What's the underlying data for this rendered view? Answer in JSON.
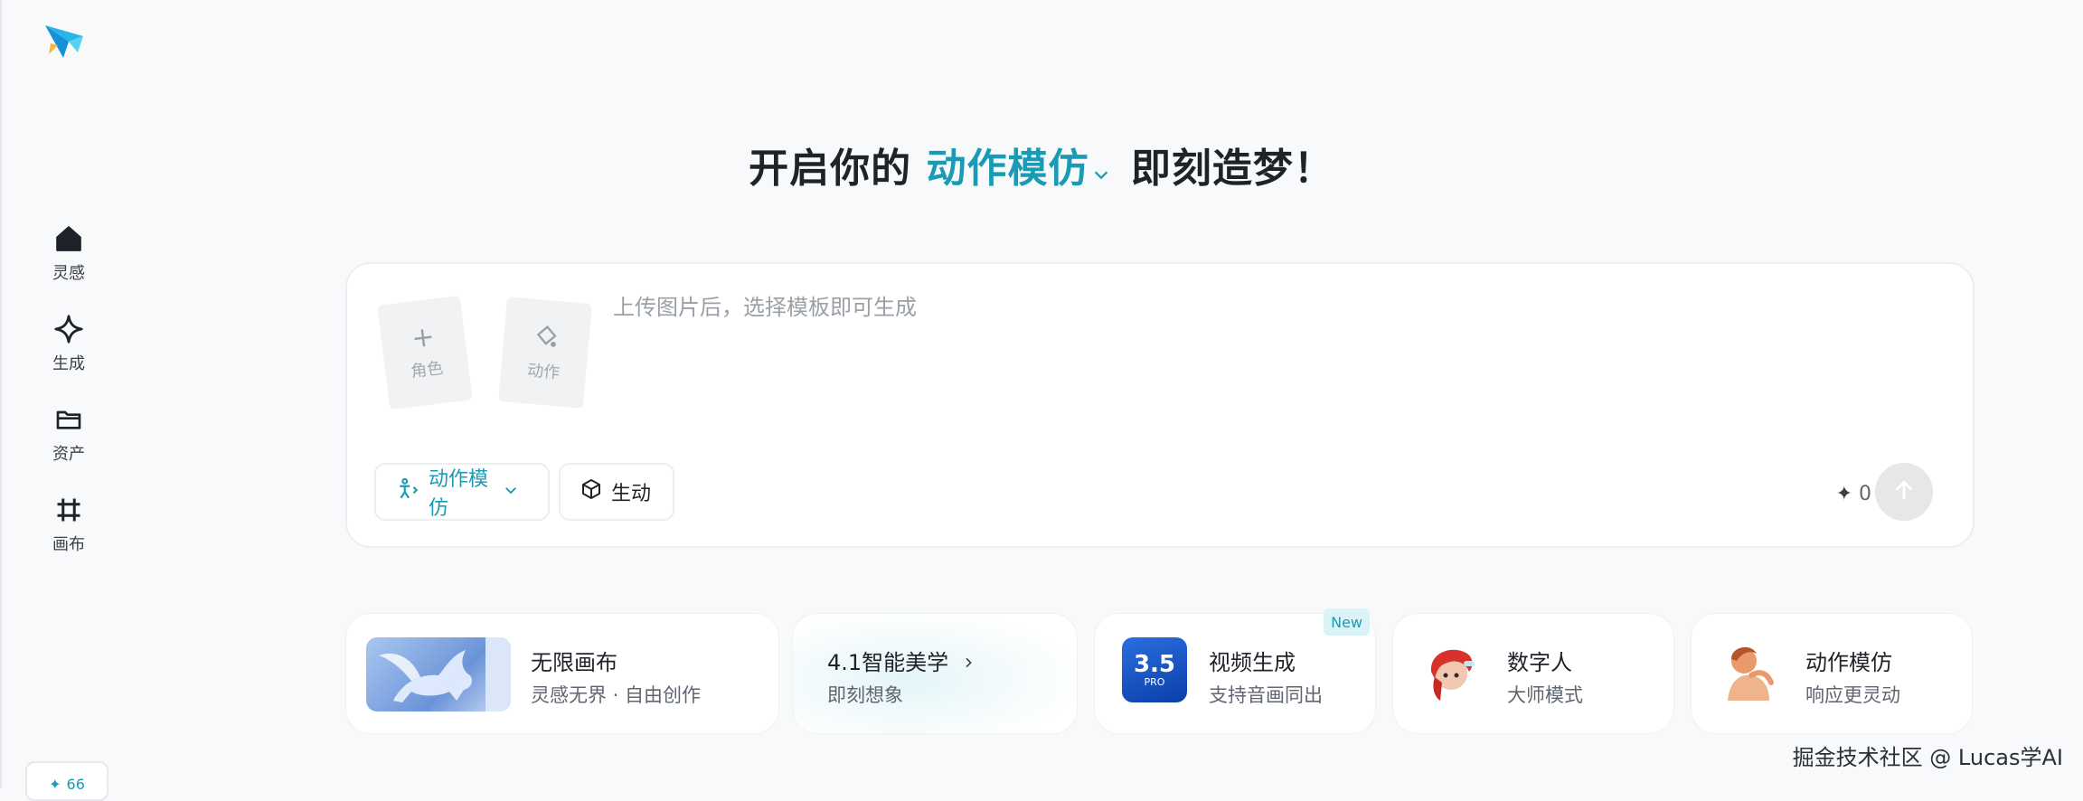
{
  "sidebar": {
    "items": [
      {
        "label": "灵感",
        "icon": "home-icon"
      },
      {
        "label": "生成",
        "icon": "sparkle-icon"
      },
      {
        "label": "资产",
        "icon": "folder-icon"
      },
      {
        "label": "画布",
        "icon": "canvas-grid-icon"
      }
    ],
    "credits": "66"
  },
  "headline": {
    "prefix": "开启你的",
    "mode": "动作模仿",
    "suffix": "即刻造梦！"
  },
  "composer": {
    "upload_character": "角色",
    "upload_action": "动作",
    "placeholder": "上传图片后，选择模板即可生成",
    "mode_pill": "动作模仿",
    "gen_pill": "生动",
    "token_count": "0"
  },
  "features": [
    {
      "title": "无限画布",
      "subtitle": "灵感无界 · 自由创作"
    },
    {
      "title": "4.1智能美学",
      "subtitle": "即刻想象"
    },
    {
      "title": "视频生成",
      "subtitle": "支持音画同出",
      "badge": "New",
      "thumb_text": "3.5",
      "thumb_sub": "PRO"
    },
    {
      "title": "数字人",
      "subtitle": "大师模式"
    },
    {
      "title": "动作模仿",
      "subtitle": "响应更灵动"
    }
  ],
  "watermark": "掘金技术社区 @ Lucas学AI",
  "colors": {
    "accent": "#1a9bb5",
    "background": "#f8f9fb"
  }
}
